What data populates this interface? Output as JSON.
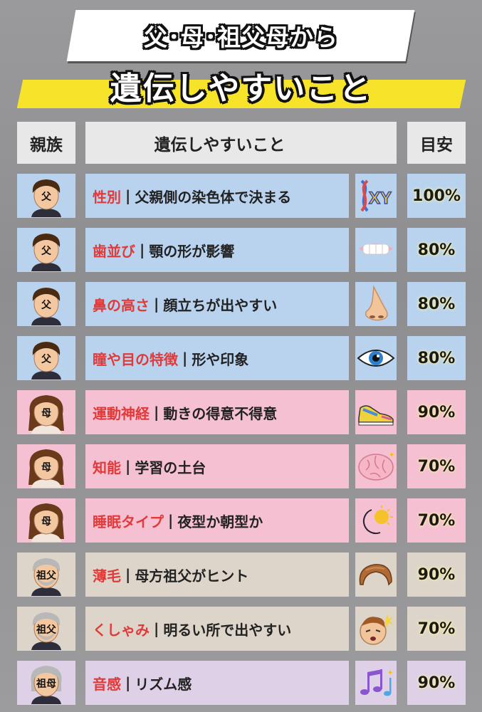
{
  "title": {
    "line1": "父･母･祖父母から",
    "line2": "遺伝しやすいこと"
  },
  "header": {
    "col_relation": "親族",
    "col_trait": "遺伝しやすいこと",
    "col_estimate": "目安"
  },
  "colors": {
    "father": "#b9d3ef",
    "mother": "#f4c0d2",
    "grandfather": "#ddd5ca",
    "grandmother": "#ddd0e7",
    "highlight": "#e03a3a",
    "banner_yellow": "#f7e42a"
  },
  "rows": [
    {
      "relation": "父",
      "trait": "性別",
      "detail": "父親側の染色体で決まる",
      "icon": "dna-xy-icon",
      "estimate": "100%"
    },
    {
      "relation": "父",
      "trait": "歯並び",
      "detail": "顎の形が影響",
      "icon": "teeth-icon",
      "estimate": "80%"
    },
    {
      "relation": "父",
      "trait": "鼻の高さ",
      "detail": "顔立ちが出やすい",
      "icon": "nose-icon",
      "estimate": "80%"
    },
    {
      "relation": "父",
      "trait": "瞳や目の特徴",
      "detail": "形や印象",
      "icon": "eye-icon",
      "estimate": "80%"
    },
    {
      "relation": "母",
      "trait": "運動神経",
      "detail": "動きの得意不得意",
      "icon": "sneaker-icon",
      "estimate": "90%"
    },
    {
      "relation": "母",
      "trait": "知能",
      "detail": "学習の土台",
      "icon": "brain-icon",
      "estimate": "70%"
    },
    {
      "relation": "母",
      "trait": "睡眠タイプ",
      "detail": "夜型か朝型か",
      "icon": "moon-sun-icon",
      "estimate": "70%"
    },
    {
      "relation": "祖父",
      "trait": "薄毛",
      "detail": "母方祖父がヒント",
      "icon": "hair-icon",
      "estimate": "90%"
    },
    {
      "relation": "祖父",
      "trait": "くしゃみ",
      "detail": "明るい所で出やすい",
      "icon": "sneeze-face-icon",
      "estimate": "70%"
    },
    {
      "relation": "祖母",
      "trait": "音感",
      "detail": "リズム感",
      "icon": "music-notes-icon",
      "estimate": "90%"
    }
  ]
}
